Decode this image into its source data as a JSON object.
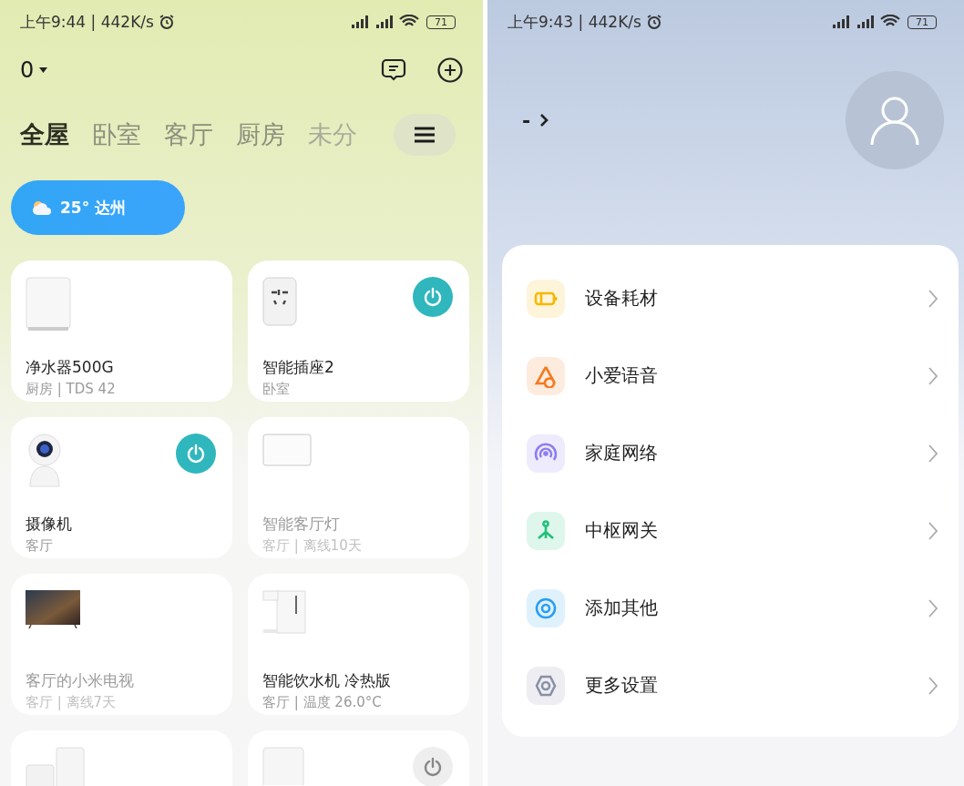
{
  "home": {
    "status_bar": {
      "time": "上午9:44 | 442K/s",
      "battery": "71"
    },
    "home_selector": "0",
    "tabs": [
      {
        "label": "全屋",
        "selected": true
      },
      {
        "label": "卧室",
        "selected": false
      },
      {
        "label": "客厅",
        "selected": false
      },
      {
        "label": "厨房",
        "selected": false
      },
      {
        "label": "未分",
        "selected": false
      }
    ],
    "weather": "25° 达州",
    "devices": [
      {
        "kind": "purifier",
        "name": "净水器500G",
        "subtitle": "厨房 | TDS 42",
        "offline": false,
        "power_button": false
      },
      {
        "kind": "plug",
        "name": "智能插座2",
        "subtitle": "卧室",
        "offline": false,
        "power_button": true,
        "on": true
      },
      {
        "kind": "camera",
        "name": "摄像机",
        "subtitle": "客厅",
        "offline": false,
        "power_button": true,
        "on": true
      },
      {
        "kind": "light",
        "name": "智能客厅灯",
        "subtitle": "客厅 | 离线10天",
        "offline": true,
        "power_button": false
      },
      {
        "kind": "tv",
        "name": "客厅的小米电视",
        "subtitle": "客厅 | 离线7天",
        "offline": true,
        "power_button": false
      },
      {
        "kind": "dispenser",
        "name": "智能饮水机 冷热版",
        "subtitle": "客厅 | 温度 26.0°C",
        "offline": false,
        "power_button": false
      },
      {
        "kind": "router",
        "power_button": false
      },
      {
        "kind": "box",
        "power_button": true,
        "on": false
      }
    ]
  },
  "profile": {
    "status_bar": {
      "time": "上午9:43 | 442K/s",
      "battery": "71"
    },
    "user_name": "-",
    "menu": [
      {
        "kind": "battery",
        "label": "设备耗材",
        "color": "#f5b800"
      },
      {
        "kind": "voice",
        "label": "小爱语音",
        "color": "#f47b20"
      },
      {
        "kind": "network",
        "label": "家庭网络",
        "color": "#8c7cf0"
      },
      {
        "kind": "hub",
        "label": "中枢网关",
        "color": "#22c07a"
      },
      {
        "kind": "add",
        "label": "添加其他",
        "color": "#2a9ff0"
      },
      {
        "kind": "settings",
        "label": "更多设置",
        "color": "#8a90a8"
      }
    ]
  }
}
